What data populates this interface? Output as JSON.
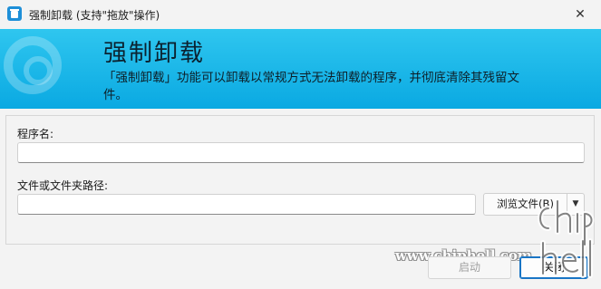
{
  "window": {
    "title": "强制卸载 (支持\"拖放\"操作)",
    "icon": "app-uninstall-icon",
    "close_icon": "close-icon"
  },
  "banner": {
    "title": "强制卸载",
    "description": "「强制卸载」功能可以卸载以常规方式无法卸载的程序，并彻底清除其残留文件。",
    "gradient_top": "#2fc6ef",
    "gradient_bottom": "#0aa9e2"
  },
  "form": {
    "program_name_label": "程序名:",
    "program_name_value": "",
    "path_label": "文件或文件夹路径:",
    "path_value": "",
    "browse_label": "浏览文件(B)",
    "browse_arrow_icon": "chevron-down-icon"
  },
  "footer": {
    "start_label": "启动",
    "close_label": "关闭"
  },
  "watermark": {
    "text": "www.chiphell.com"
  },
  "colors": {
    "accent": "#1975c5",
    "window_bg": "#f3f3f3"
  }
}
